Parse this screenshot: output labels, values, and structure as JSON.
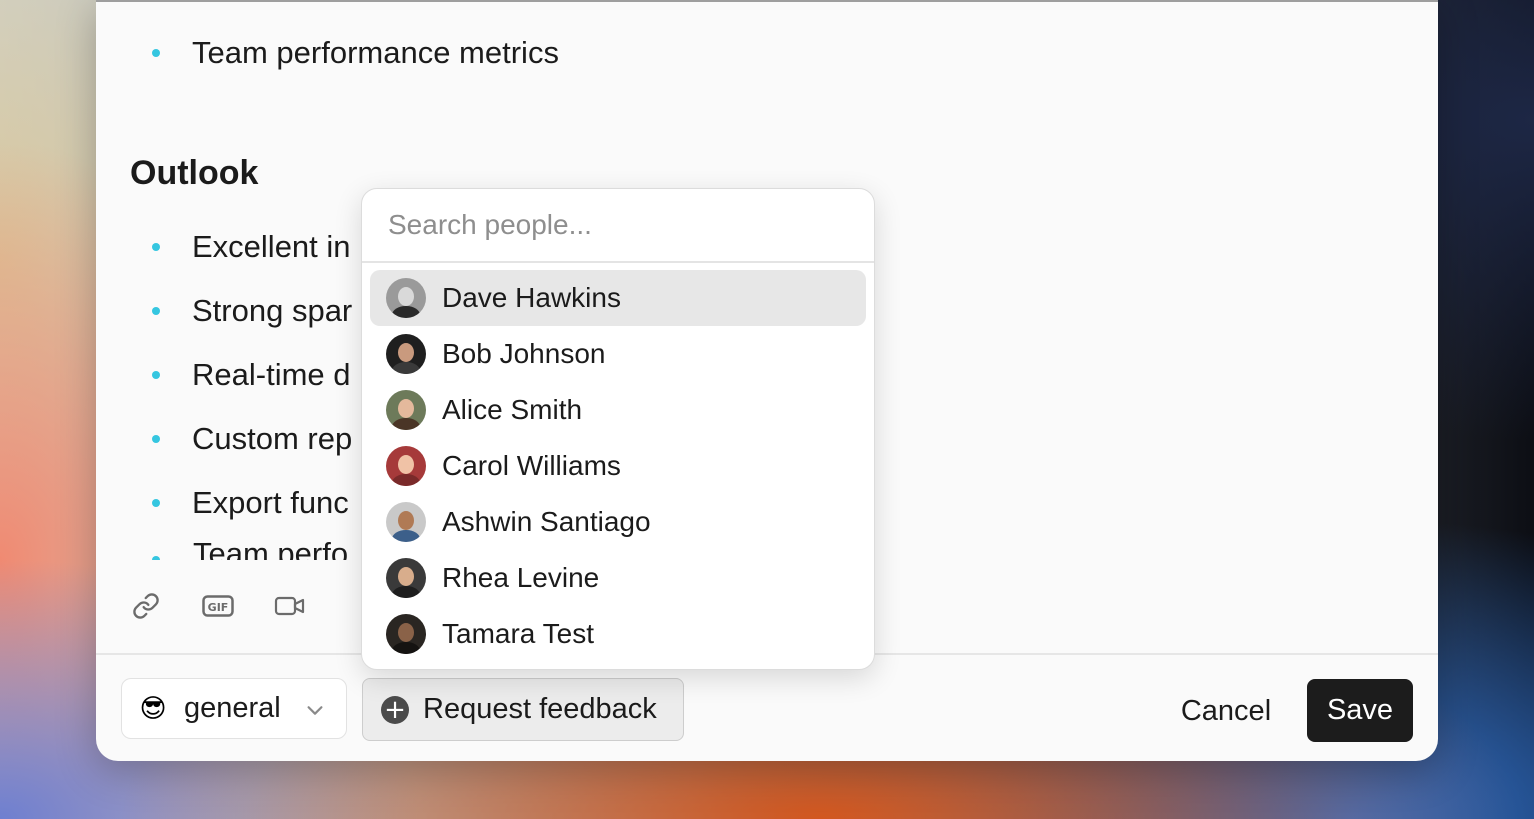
{
  "document": {
    "top_bullet": "Team performance metrics",
    "heading": "Outlook",
    "bullets": [
      "Excellent in",
      "Strong spar",
      "Real-time d",
      "Custom rep",
      "Export func"
    ],
    "cut_bullet": "Team perfo"
  },
  "toolbar": {
    "icons": [
      "link-icon",
      "gif-icon",
      "video-icon"
    ],
    "gif_label": "GIF"
  },
  "footer": {
    "channel_emoji": "😎",
    "channel_label": "general",
    "request_feedback_label": "Request feedback",
    "cancel_label": "Cancel",
    "save_label": "Save"
  },
  "people_dropdown": {
    "search_placeholder": "Search people...",
    "people": [
      {
        "name": "Dave Hawkins",
        "highlighted": true
      },
      {
        "name": "Bob Johnson",
        "highlighted": false
      },
      {
        "name": "Alice Smith",
        "highlighted": false
      },
      {
        "name": "Carol Williams",
        "highlighted": false
      },
      {
        "name": "Ashwin Santiago",
        "highlighted": false
      },
      {
        "name": "Rhea Levine",
        "highlighted": false
      },
      {
        "name": "Tamara Test",
        "highlighted": false
      }
    ]
  },
  "colors": {
    "bullet": "#35c6e0",
    "save_button": "#1c1c1c",
    "highlight_row": "#e7e7e7"
  }
}
